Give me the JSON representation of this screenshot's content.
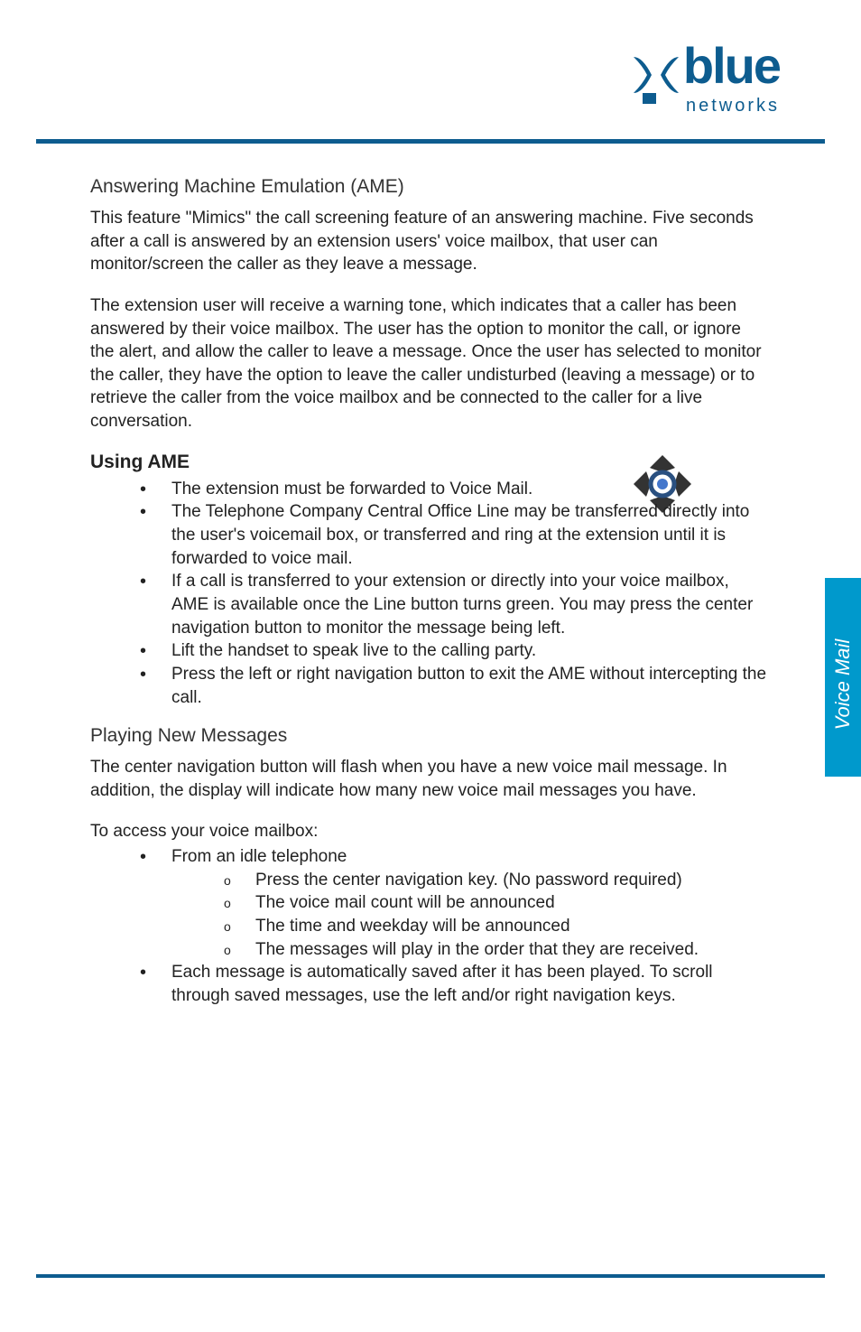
{
  "logo": {
    "brand_part1": "blue",
    "brand_part2": "networks"
  },
  "side_tab": "Voice Mail",
  "section1": {
    "title": "Answering Machine Emulation (AME)",
    "para1": "This feature \"Mimics\" the call screening feature of an answering machine. Five seconds after a call is answered by an extension users' voice mailbox, that user can monitor/screen the caller as they leave a message.",
    "para2": "The extension user will receive a warning tone, which indicates that a caller has been answered by their voice mailbox.  The user has the option to monitor the call, or ignore the alert, and allow the caller to leave a message.  Once the user has selected to monitor the caller, they have the option to leave the caller undisturbed (leaving a message) or to retrieve the caller from the voice mailbox and be connected to the caller for a live conversation."
  },
  "using_ame": {
    "heading": "Using AME",
    "bullets": [
      "The extension must be forwarded to Voice Mail.",
      "The Telephone Company Central Office Line may be transferred directly into the user's voicemail box, or transferred and ring at the extension until it is forwarded to voice mail.",
      "If a call is transferred to your extension or directly into your voice mailbox, AME is available once the Line button turns green. You may press the center navigation button to monitor the message being left.",
      "Lift the handset to speak live to the calling party.",
      "Press the left or right navigation button to exit the AME without intercepting the call."
    ]
  },
  "section2": {
    "title": "Playing New Messages",
    "para1": "The center navigation button will flash when you have a new voice mail message.  In addition, the display will indicate how many new voice mail messages you have.",
    "intro2": "To access your voice mailbox:",
    "bullets": [
      {
        "text": "From an idle telephone",
        "sub": [
          "Press the center navigation key. (No password required)",
          "The voice mail count will be announced",
          "The time and weekday will be announced",
          "The messages will play in the order that they are received."
        ]
      },
      {
        "text": "Each message is automatically saved after it has been played.  To scroll through saved messages, use the left and/or right navigation keys.",
        "sub": []
      }
    ]
  }
}
